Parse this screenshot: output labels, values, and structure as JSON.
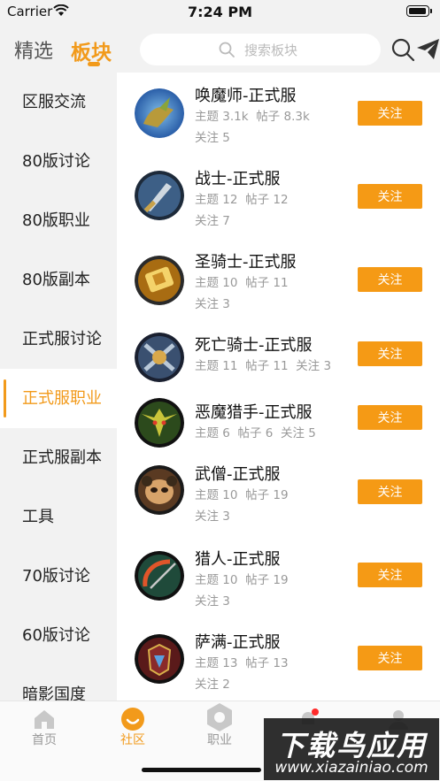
{
  "status_bar": {
    "carrier": "Carrier",
    "time": "7:24 PM"
  },
  "header": {
    "tab_select": "精选",
    "tab_board": "板块",
    "search_placeholder": "搜索板块"
  },
  "sidebar": {
    "items": [
      {
        "label": "区服交流"
      },
      {
        "label": "80版讨论"
      },
      {
        "label": "80版职业"
      },
      {
        "label": "80版副本"
      },
      {
        "label": "正式服讨论"
      },
      {
        "label": "正式服职业"
      },
      {
        "label": "正式服副本"
      },
      {
        "label": "工具"
      },
      {
        "label": "70版讨论"
      },
      {
        "label": "60版讨论"
      },
      {
        "label": "暗影国度"
      }
    ],
    "active_index": 5
  },
  "boards": [
    {
      "title": "唤魔师-正式服",
      "topics": "主题 3.1k",
      "posts": "帖子 8.3k",
      "follows": "关注 5",
      "inline": false,
      "follow_label": "关注",
      "colors": [
        "#3a7bc8",
        "#e0b04a"
      ]
    },
    {
      "title": "战士-正式服",
      "topics": "主题 12",
      "posts": "帖子 12",
      "follows": "关注 7",
      "inline": false,
      "follow_label": "关注",
      "colors": [
        "#3d5f86",
        "#cfd8e0"
      ]
    },
    {
      "title": "圣骑士-正式服",
      "topics": "主题 10",
      "posts": "帖子 11",
      "follows": "关注 3",
      "inline": false,
      "follow_label": "关注",
      "colors": [
        "#a86c12",
        "#f4d36a"
      ]
    },
    {
      "title": "死亡骑士-正式服",
      "topics": "主题 11",
      "posts": "帖子 11",
      "follows": "关注 3",
      "inline": true,
      "follow_label": "关注",
      "colors": [
        "#3a5070",
        "#b9c8d8"
      ]
    },
    {
      "title": "恶魔猎手-正式服",
      "topics": "主题 6",
      "posts": "帖子 6",
      "follows": "关注 5",
      "inline": true,
      "follow_label": "关注",
      "colors": [
        "#2c4a1c",
        "#c9c43a"
      ]
    },
    {
      "title": "武僧-正式服",
      "topics": "主题 10",
      "posts": "帖子 19",
      "follows": "关注 3",
      "inline": false,
      "follow_label": "关注",
      "colors": [
        "#5a3a22",
        "#d7a36a"
      ]
    },
    {
      "title": "猎人-正式服",
      "topics": "主题 10",
      "posts": "帖子 19",
      "follows": "关注 3",
      "inline": false,
      "follow_label": "关注",
      "colors": [
        "#1f4a3a",
        "#e0552a"
      ]
    },
    {
      "title": "萨满-正式服",
      "topics": "主题 13",
      "posts": "帖子 13",
      "follows": "关注 2",
      "inline": false,
      "follow_label": "关注",
      "colors": [
        "#5a1a1a",
        "#5aa0e0"
      ]
    }
  ],
  "tabbar": {
    "items": [
      {
        "label": "首页"
      },
      {
        "label": "社区"
      },
      {
        "label": "职业"
      },
      {
        "label": ""
      },
      {
        "label": ""
      }
    ]
  },
  "watermark": {
    "main": "下载鸟应用",
    "sub": "www.xiazainiao.com"
  },
  "colors": {
    "accent": "#f29a1b",
    "button": "#f59a15",
    "badge": "#ff2a2a"
  }
}
